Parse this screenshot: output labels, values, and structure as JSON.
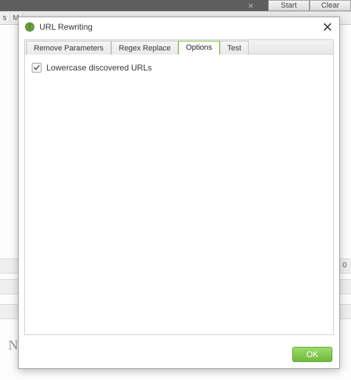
{
  "background": {
    "toolbar_close_glyph": "×",
    "start_button": "Start",
    "clear_button": "Clear",
    "row2_left_a": "s",
    "row2_left_b": "M",
    "plus_glyph": "+",
    "zero_value": "0",
    "letter_n": "N"
  },
  "dialog": {
    "title": "URL Rewriting",
    "tabs": {
      "remove_parameters": "Remove Parameters",
      "regex_replace": "Regex Replace",
      "options": "Options",
      "test": "Test"
    },
    "options_panel": {
      "lowercase_checkbox_label": "Lowercase discovered URLs",
      "lowercase_checked": true
    },
    "ok_button": "OK"
  }
}
